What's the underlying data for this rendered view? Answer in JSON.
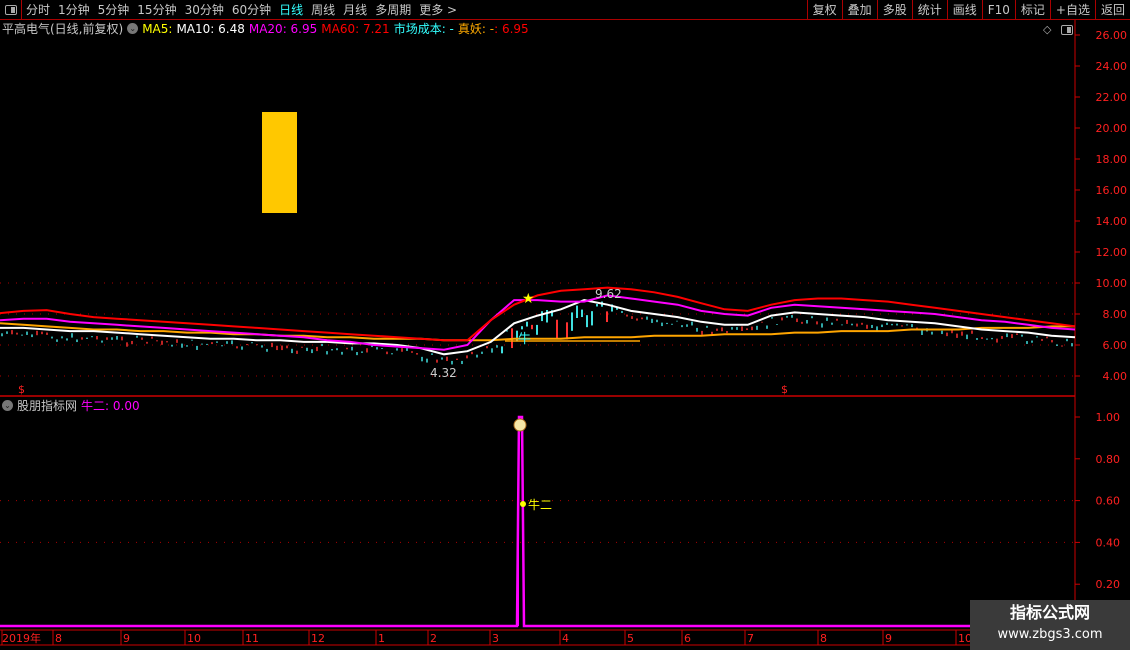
{
  "toolbar": {
    "periods": [
      "分时",
      "1分钟",
      "5分钟",
      "15分钟",
      "30分钟",
      "60分钟",
      "日线",
      "周线",
      "月线",
      "多周期",
      "更多 >"
    ],
    "active": "日线",
    "right_buttons": [
      "复权",
      "叠加",
      "多股",
      "统计",
      "画线",
      "F10",
      "标记",
      "+自选",
      "返回"
    ]
  },
  "main_info": {
    "title": "平高电气(日线,前复权)",
    "ma5": "MA5:",
    "ma10": "MA10: 6.48",
    "ma20": "MA20: 6.95",
    "ma60": "MA60: 7.21",
    "cost": "市场成本: -",
    "zhenyao": "真妖: -",
    "zhenyao_val": ": 6.95"
  },
  "sub_info": {
    "title": "股朋指标网",
    "value": "牛二: 0.00",
    "marker_label": "牛二"
  },
  "colors": {
    "ma5": "#ffff00",
    "ma10": "#ffffff",
    "ma20": "#ff00ff",
    "ma60": "#ff0000",
    "cost": "#00ffff",
    "zhenyao": "#ffa500",
    "axis": "#ff2020",
    "grid": "#a00000",
    "signal_block": "#ffc800"
  },
  "chart_data": [
    {
      "type": "line",
      "yaxis_ticks": [
        "26.00",
        "24.00",
        "22.00",
        "20.00",
        "18.00",
        "16.00",
        "14.00",
        "12.00",
        "10.00",
        "8.00",
        "6.00",
        "4.00"
      ],
      "ylim": [
        4,
        26
      ],
      "annotations": {
        "high": "9.62",
        "low": "4.32"
      },
      "series": [
        {
          "name": "MA60",
          "color": "#ff0000",
          "values": [
            8.06,
            8.2,
            8.25,
            8.0,
            7.8,
            7.7,
            7.6,
            7.5,
            7.4,
            7.3,
            7.2,
            7.1,
            7.0,
            6.9,
            6.8,
            6.7,
            6.6,
            6.5,
            6.4,
            6.3,
            6.3,
            7.6,
            8.6,
            9.2,
            9.5,
            9.6,
            9.7,
            9.6,
            9.4,
            9.1,
            8.7,
            8.3,
            8.2,
            8.6,
            8.9,
            9.0,
            9.0,
            8.9,
            8.8,
            8.6,
            8.4,
            8.2,
            8.0,
            7.8,
            7.6,
            7.4,
            7.2
          ]
        },
        {
          "name": "MA20",
          "color": "#ff00ff",
          "values": [
            7.6,
            7.7,
            7.7,
            7.5,
            7.4,
            7.3,
            7.2,
            7.1,
            7.0,
            6.9,
            6.8,
            6.7,
            6.6,
            6.5,
            6.3,
            6.2,
            6.0,
            5.9,
            5.8,
            5.7,
            6.0,
            7.6,
            8.9,
            8.9,
            8.8,
            8.8,
            9.2,
            9.0,
            8.8,
            8.6,
            8.2,
            8.0,
            7.9,
            8.4,
            8.6,
            8.5,
            8.4,
            8.3,
            8.2,
            8.1,
            8.0,
            7.8,
            7.6,
            7.5,
            7.3,
            7.1,
            7.0
          ]
        },
        {
          "name": "MA10",
          "color": "#ffffff",
          "values": [
            7.1,
            7.1,
            7.0,
            6.9,
            6.9,
            6.8,
            6.7,
            6.6,
            6.5,
            6.4,
            6.4,
            6.3,
            6.3,
            6.2,
            6.2,
            6.1,
            6.1,
            6.0,
            5.8,
            5.4,
            5.6,
            6.2,
            7.4,
            7.9,
            8.3,
            8.9,
            8.6,
            8.2,
            8.0,
            7.8,
            7.5,
            7.3,
            7.3,
            7.9,
            8.1,
            8.0,
            7.9,
            7.8,
            7.6,
            7.5,
            7.4,
            7.2,
            7.0,
            6.9,
            6.8,
            6.6,
            6.5
          ]
        },
        {
          "name": "市场成本",
          "color": "#ffa500",
          "values": [
            7.4,
            7.3,
            7.2,
            7.1,
            7.0,
            7.0,
            6.9,
            6.9,
            6.8,
            6.8,
            6.7,
            6.7,
            6.6,
            6.6,
            6.5,
            6.5,
            6.4,
            6.4,
            6.4,
            6.3,
            6.3,
            6.3,
            6.4,
            6.4,
            6.4,
            6.5,
            6.5,
            6.5,
            6.6,
            6.6,
            6.6,
            6.7,
            6.7,
            6.7,
            6.8,
            6.8,
            6.9,
            6.9,
            6.9,
            7.0,
            7.0,
            7.0,
            7.1,
            7.1,
            7.1,
            7.2,
            7.2
          ]
        }
      ]
    },
    {
      "type": "line",
      "name": "牛二",
      "yaxis_ticks": [
        "1.00",
        "0.80",
        "0.60",
        "0.40",
        "0.20"
      ],
      "ylim": [
        0,
        1.1
      ],
      "spike_value": 1.0,
      "baseline": 0.0
    },
    {
      "type": "axis",
      "xaxis_ticks": [
        "2019年",
        "8",
        "9",
        "10",
        "11",
        "12",
        "1",
        "2",
        "3",
        "4",
        "5",
        "6",
        "7",
        "8",
        "9",
        "10"
      ]
    }
  ],
  "watermark": {
    "name": "指标公式网",
    "url": "www.zbgs3.com"
  }
}
